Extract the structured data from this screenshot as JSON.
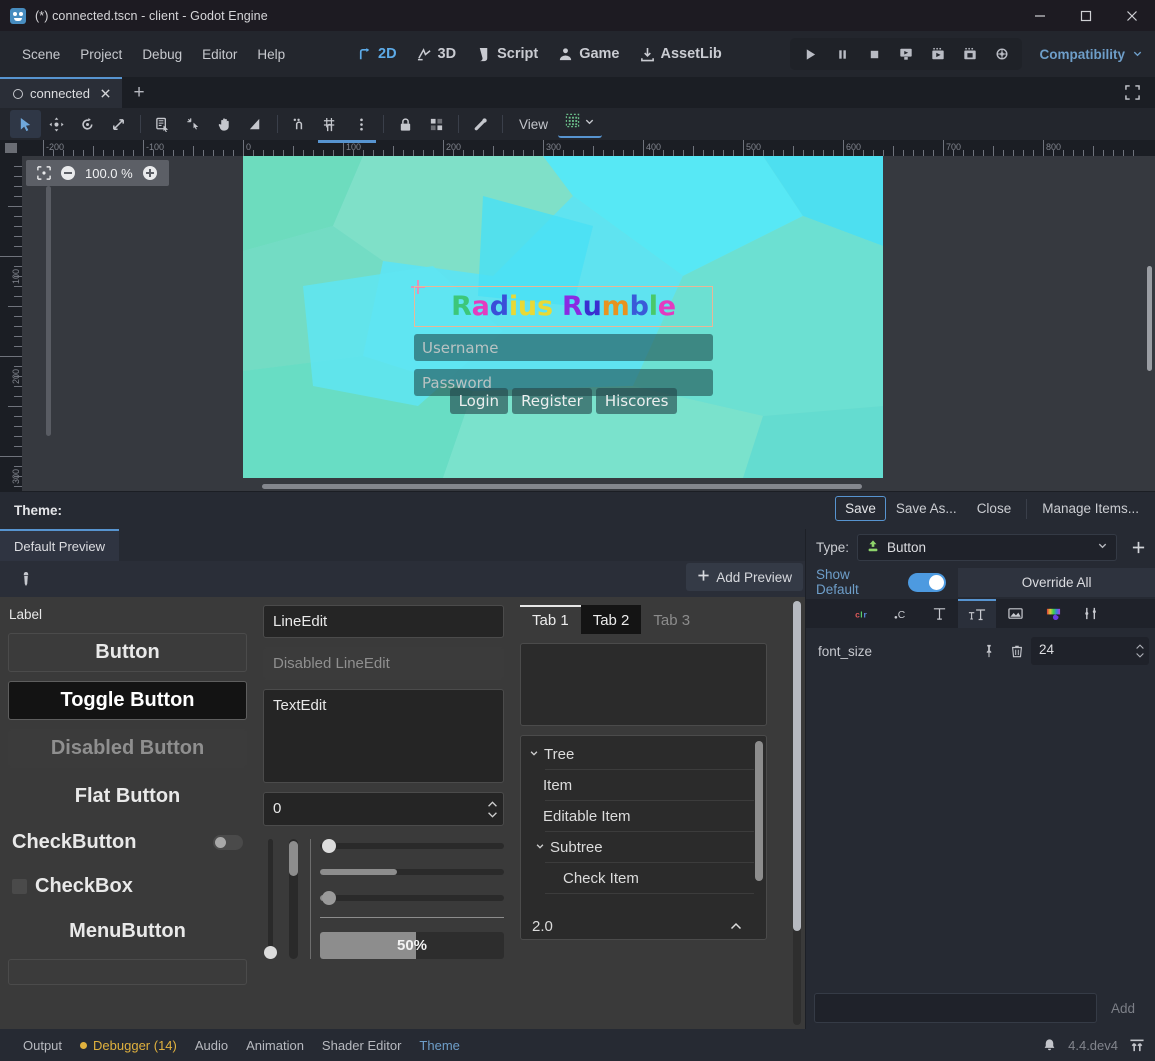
{
  "window": {
    "title": "(*) connected.tscn - client - Godot Engine",
    "app_icon": "godot-robot-icon",
    "minimize": "minimize-icon",
    "maximize": "maximize-icon",
    "close": "close-icon"
  },
  "menubar": {
    "items": [
      "Scene",
      "Project",
      "Debug",
      "Editor",
      "Help"
    ],
    "main_buttons": [
      {
        "label": "2D",
        "icon": "2d-icon",
        "active": true
      },
      {
        "label": "3D",
        "icon": "3d-icon",
        "active": false
      },
      {
        "label": "Script",
        "icon": "script-icon",
        "active": false
      },
      {
        "label": "Game",
        "icon": "game-icon",
        "active": false
      },
      {
        "label": "AssetLib",
        "icon": "assetlib-icon",
        "active": false
      }
    ],
    "play_buttons": [
      "play-icon",
      "pause-icon",
      "stop-icon",
      "play-scene-icon",
      "play-custom-icon",
      "movie-maker-icon",
      "remote-debug-icon"
    ],
    "renderer": "Compatibility",
    "renderer_chevron": "chevron-down-icon"
  },
  "scene_tabs": {
    "tabs": [
      {
        "label": "connected",
        "unsaved_icon": "circle-icon",
        "close_icon": "close-icon"
      }
    ],
    "add_tab": "+",
    "fullscreen": "expand-icon"
  },
  "canvas_toolbar": {
    "tools": [
      "select-tool-icon",
      "move-tool-icon",
      "rotate-tool-icon",
      "scale-tool-icon",
      "list-select-icon",
      "pivot-icon",
      "pan-icon",
      "ruler-icon",
      "snap-mode-icon",
      "grid-snap-icon",
      "snap-options-icon",
      "lock-icon",
      "group-icon",
      "bone-icon"
    ],
    "view_label": "View",
    "grid_button": "grid-visibility-icon",
    "grid_chevron": "chevron-down-icon"
  },
  "viewport": {
    "zoom": {
      "fit_icon": "zoom-fit-icon",
      "minus_icon": "zoom-out-icon",
      "value": "100.0 %",
      "plus_icon": "zoom-in-icon"
    },
    "ruler_h_labels": [
      "-200",
      "-100",
      "0",
      "100",
      "200",
      "300",
      "400",
      "500",
      "600",
      "700",
      "800"
    ],
    "ruler_v_labels": [
      "100",
      "200",
      "300"
    ],
    "game": {
      "title_letters": [
        {
          "char": "R",
          "color": "#3cc77a"
        },
        {
          "char": "a",
          "color": "#e23cc0"
        },
        {
          "char": "d",
          "color": "#3a4fd8"
        },
        {
          "char": "i",
          "color": "#e8d935"
        },
        {
          "char": "u",
          "color": "#e8d935"
        },
        {
          "char": "s",
          "color": "#e8d935"
        },
        {
          "char": " ",
          "color": "#ffffff"
        },
        {
          "char": "R",
          "color": "#8a2be2"
        },
        {
          "char": "u",
          "color": "#3a2fd0"
        },
        {
          "char": "m",
          "color": "#e8931f"
        },
        {
          "char": "b",
          "color": "#3a5ad8"
        },
        {
          "char": "l",
          "color": "#49c96a"
        },
        {
          "char": "e",
          "color": "#e23cc0"
        }
      ],
      "username_placeholder": "Username",
      "password_placeholder": "Password",
      "buttons": [
        "Login",
        "Register",
        "Hiscores"
      ],
      "crosshair": "crosshair-icon"
    }
  },
  "theme_editor": {
    "header_label": "Theme:",
    "actions": [
      {
        "label": "Save",
        "focused": true
      },
      {
        "label": "Save As...",
        "focused": false
      },
      {
        "label": "Close",
        "focused": false
      }
    ],
    "manage_items": "Manage Items...",
    "preview_tabs": [
      {
        "label": "Default Preview",
        "active": true
      }
    ],
    "add_preview": {
      "label": "Add Preview",
      "icon": "plus-icon"
    },
    "color_picker_tool": "eyedropper-icon",
    "preview": {
      "label": "Label",
      "button": "Button",
      "toggle_button": "Toggle Button",
      "disabled_button": "Disabled Button",
      "flat_button": "Flat Button",
      "check_button": "CheckButton",
      "check_box": "CheckBox",
      "menu_button": "MenuButton",
      "line_edit": "LineEdit",
      "disabled_line_edit": "Disabled LineEdit",
      "text_edit": "TextEdit",
      "spinbox_value": "0",
      "progress_value": "50%",
      "tabs": [
        {
          "label": "Tab 1",
          "state": "active"
        },
        {
          "label": "Tab 2",
          "state": "hover"
        },
        {
          "label": "Tab 3",
          "state": "disabled"
        }
      ],
      "tree": [
        {
          "label": "Tree",
          "indent": 0,
          "arrow": "chevron-down-icon"
        },
        {
          "label": "Item",
          "indent": 1,
          "arrow": ""
        },
        {
          "label": "Editable Item",
          "indent": 1,
          "arrow": ""
        },
        {
          "label": "Subtree",
          "indent": 1,
          "arrow": "chevron-down-icon"
        },
        {
          "label": "Check Item",
          "indent": 2,
          "arrow": ""
        }
      ],
      "tree_spin_value": "2.0"
    }
  },
  "properties": {
    "type_label": "Type:",
    "type_value": "Button",
    "type_icon": "button-node-icon",
    "type_chevron": "chevron-down-icon",
    "add_type_icon": "plus-icon",
    "show_default_label": "Show Default",
    "show_default_on": true,
    "override_all": "Override All",
    "tabs": [
      {
        "icon": "color-items-icon",
        "label": "clr",
        "selected": false
      },
      {
        "icon": "constant-items-icon",
        "label": ".c",
        "selected": false
      },
      {
        "icon": "font-items-icon",
        "label": "T",
        "selected": false
      },
      {
        "icon": "font-size-items-icon",
        "label": "fT",
        "selected": true
      },
      {
        "icon": "icon-items-icon",
        "label": "",
        "selected": false
      },
      {
        "icon": "stylebox-items-icon",
        "label": "",
        "selected": false
      },
      {
        "icon": "misc-items-icon",
        "label": "",
        "selected": false
      }
    ],
    "rows": [
      {
        "name": "font_size",
        "pin_icon": "pin-icon",
        "delete_icon": "trash-icon",
        "value": "24"
      }
    ],
    "add_field_value": "",
    "add_button": "Add"
  },
  "statusbar": {
    "items": [
      {
        "label": "Output",
        "style": "normal"
      },
      {
        "label": "Debugger (14)",
        "style": "warning"
      },
      {
        "label": "Audio",
        "style": "normal"
      },
      {
        "label": "Animation",
        "style": "normal"
      },
      {
        "label": "Shader Editor",
        "style": "normal"
      },
      {
        "label": "Theme",
        "style": "active"
      }
    ],
    "bell_icon": "bell-icon",
    "version": "4.4.dev4",
    "layout_icon": "expand-bottom-icon"
  },
  "colors": {
    "accent": "#5794d0",
    "warning": "#e0b13e",
    "bg_dark": "#1b1e24",
    "bg_panel": "#262a33"
  }
}
